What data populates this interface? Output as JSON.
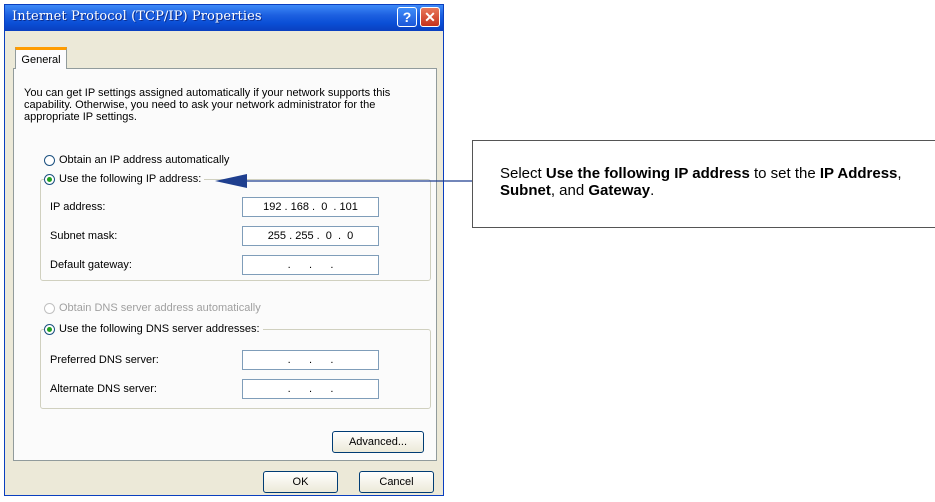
{
  "window": {
    "title": "Internet Protocol (TCP/IP) Properties",
    "help_glyph": "?",
    "close_glyph": "✕"
  },
  "tab": {
    "label": "General"
  },
  "intro_text": "You can get IP settings assigned automatically if your network supports this capability. Otherwise, you need to ask your network administrator for the appropriate IP settings.",
  "ip": {
    "auto_label": "Obtain an IP address automatically",
    "manual_label": "Use the following IP address:",
    "address_label": "IP address:",
    "address_value": "192 . 168 .  0  . 101",
    "subnet_label": "Subnet mask:",
    "subnet_value": "255 . 255 .  0  .  0",
    "gateway_label": "Default gateway:",
    "gateway_value": " .      .      . "
  },
  "dns": {
    "auto_label": "Obtain DNS server address automatically",
    "manual_label": "Use the following DNS server addresses:",
    "preferred_label": "Preferred DNS server:",
    "preferred_value": " .      .      . ",
    "alternate_label": "Alternate DNS server:",
    "alternate_value": " .      .      . "
  },
  "buttons": {
    "advanced": "Advanced...",
    "ok": "OK",
    "cancel": "Cancel"
  },
  "callout": {
    "p1": "Select ",
    "b1": "Use the following IP address",
    "p2": " to set the ",
    "b2": "IP Address",
    "p3": ", ",
    "b3": "Subnet",
    "p4": ", and ",
    "b4": "Gateway",
    "p5": "."
  },
  "colors": {
    "titlebar": "#0a4fd6",
    "tab_accent": "#ff9c00",
    "radio_dot": "#21a121",
    "arrow": "#1f3f8f"
  }
}
